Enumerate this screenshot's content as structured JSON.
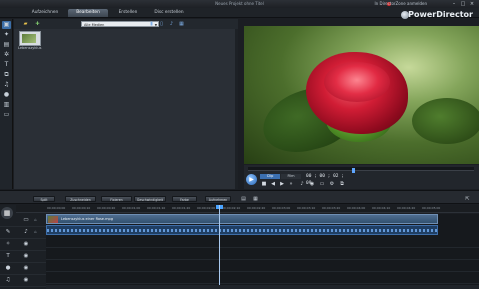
{
  "app": {
    "window_title": "Neues Projekt ohne Titel",
    "login_link": "In DirectorZone anmelden",
    "brand": "PowerDirector",
    "window_buttons": {
      "minimize": "–",
      "maximize": "□",
      "close": "×"
    }
  },
  "menu": {
    "tabs": [
      {
        "label": "Aufzeichnen",
        "active": false
      },
      {
        "label": "Bearbeiten",
        "active": true
      },
      {
        "label": "Erstellen",
        "active": false
      },
      {
        "label": "Disc erstellen",
        "active": false
      }
    ]
  },
  "left_tools": [
    "media-room-icon",
    "effects-icon",
    "pip-icon",
    "particle-icon",
    "title-icon",
    "transition-icon",
    "audio-mix-icon",
    "voiceover-icon",
    "chapter-icon",
    "subtitle-icon"
  ],
  "library": {
    "filter_value": "Alle Medien",
    "clips": [
      {
        "label": "Lebenszyklus"
      }
    ]
  },
  "transport": {
    "mode_clip": "Clip",
    "mode_film": "Film",
    "timecode": "00 ; 00 ; 02 ; 09",
    "scrub_position": 0.46
  },
  "timeline_toolbar": {
    "buttons": [
      "Split",
      "Zuschneiden",
      "Fixieren",
      "Geschwindigkeit",
      "Farbe",
      "Aufnehmen"
    ]
  },
  "ruler": {
    "ticks": [
      "00;00;00;00",
      "00;00;00;10",
      "00;00;00;20",
      "00;00;01;00",
      "00;00;01;10",
      "00;00;01;20",
      "00;00;02;00",
      "00;00;02;10",
      "00;00;02;20",
      "00;00;03;00",
      "00;00;03;10",
      "00;00;03;20",
      "00;00;04;00",
      "00;00;04;10",
      "00;00;04;20",
      "00;00;05;00"
    ]
  },
  "timeline": {
    "video_clip_title": "Lebenszyklus einer Rose.mpg",
    "playhead_position": 0.4
  }
}
